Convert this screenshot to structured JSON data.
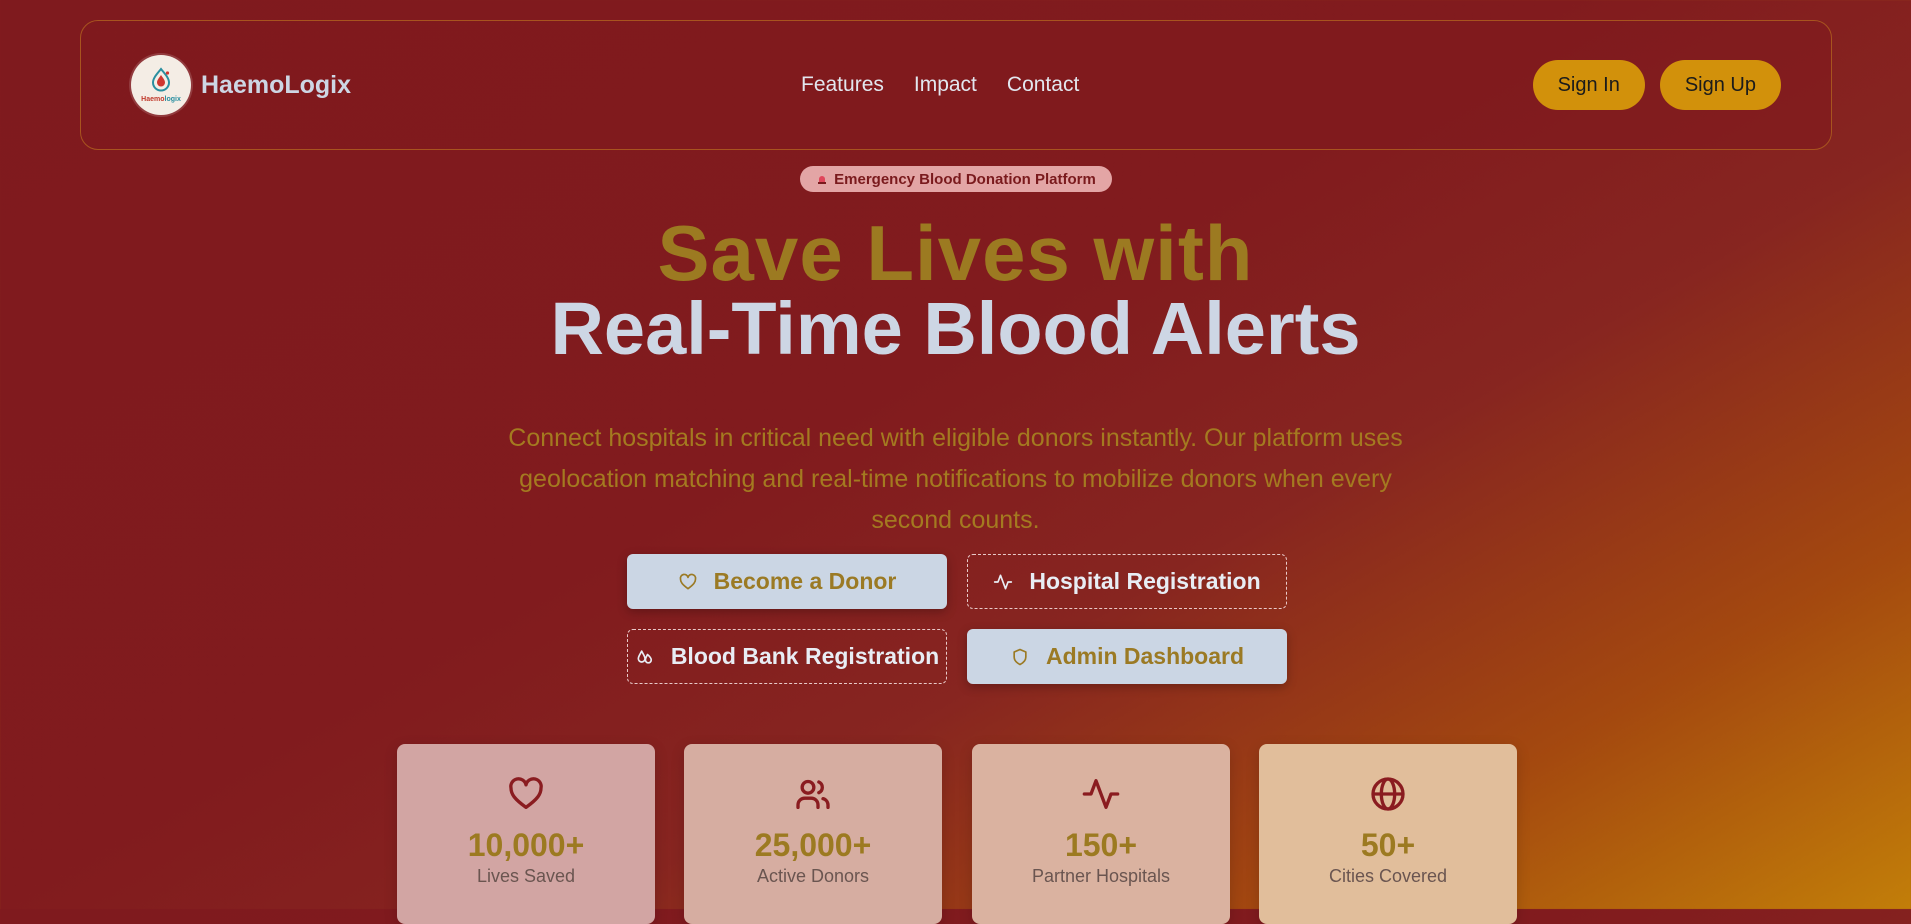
{
  "brand": {
    "name": "HaemoLogix",
    "logo_text_left": "Haemo",
    "logo_text_right": "logix",
    "logo_icon": "blood-drop-pin-icon"
  },
  "nav": {
    "links": [
      "Features",
      "Impact",
      "Contact"
    ]
  },
  "auth": {
    "sign_in": "Sign In",
    "sign_up": "Sign Up"
  },
  "hero": {
    "badge": {
      "icon": "siren-icon",
      "text": "Emergency Blood Donation Platform"
    },
    "title_line1": "Save Lives with",
    "title_line2": "Real-Time Blood Alerts",
    "description": "Connect hospitals in critical need with eligible donors instantly. Our platform uses geolocation matching and real-time notifications to mobilize donors when every second counts."
  },
  "actions": [
    {
      "label": "Become a Donor",
      "icon": "heart-icon",
      "style": "solid"
    },
    {
      "label": "Hospital Registration",
      "icon": "activity-icon",
      "style": "outline"
    },
    {
      "label": "Blood Bank Registration",
      "icon": "droplets-icon",
      "style": "outline"
    },
    {
      "label": "Admin Dashboard",
      "icon": "shield-icon",
      "style": "solid"
    }
  ],
  "stats": [
    {
      "value": "10,000+",
      "label": "Lives Saved",
      "icon": "heart-icon"
    },
    {
      "value": "25,000+",
      "label": "Active Donors",
      "icon": "users-icon"
    },
    {
      "value": "150+",
      "label": "Partner Hospitals",
      "icon": "activity-icon"
    },
    {
      "value": "50+",
      "label": "Cities Covered",
      "icon": "globe-icon"
    }
  ],
  "colors": {
    "background_start": "#7f1a1e",
    "background_end": "#c27e09",
    "accent_gold": "#9c7a21",
    "button_amber": "#d2910b",
    "light_slate": "#cdd6e4",
    "icon_red": "#8a1c20"
  }
}
